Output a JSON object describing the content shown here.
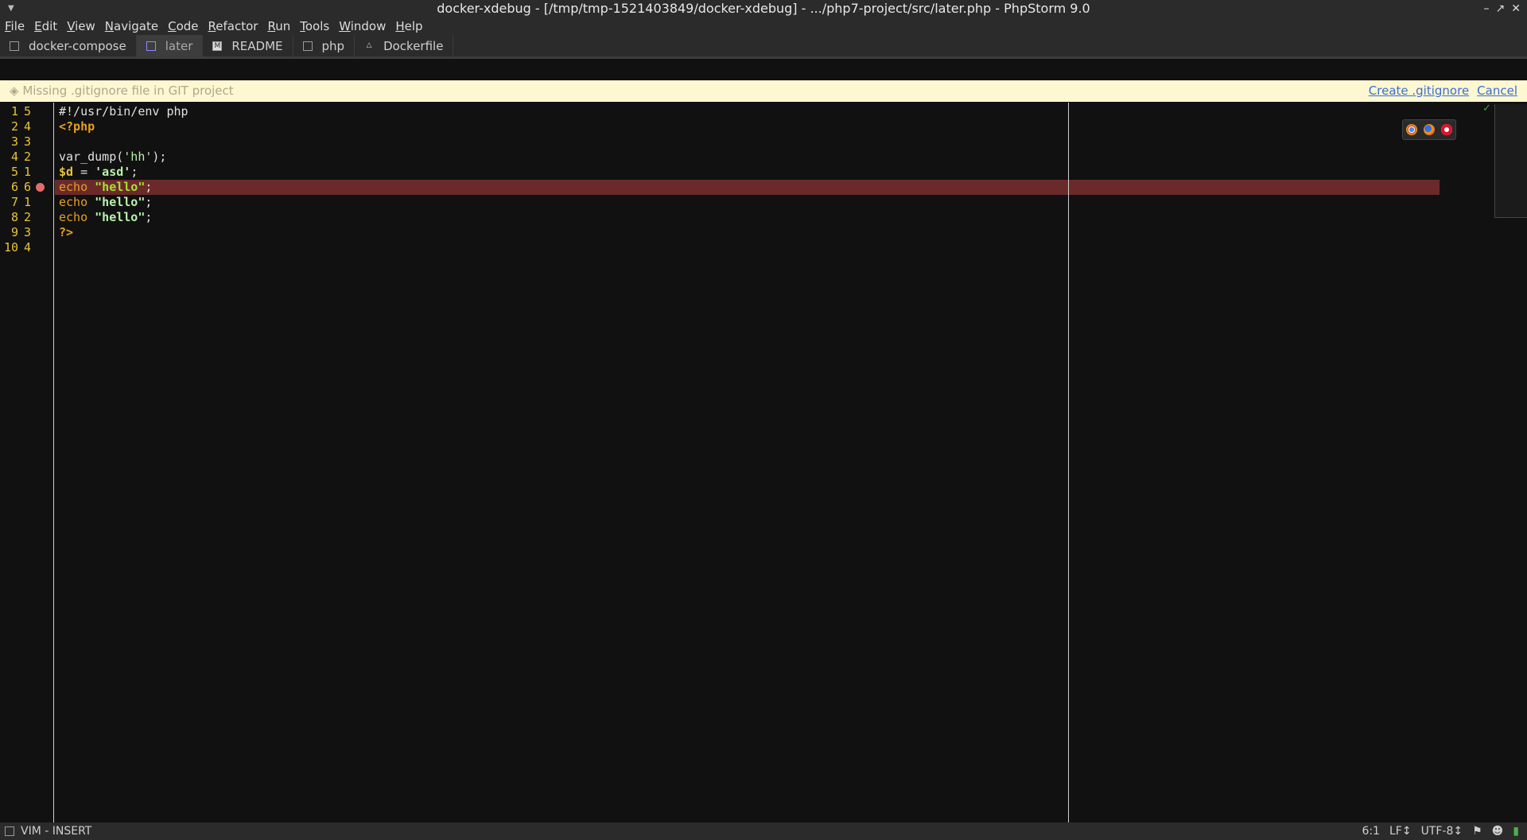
{
  "window": {
    "title": "docker-xdebug - [/tmp/tmp-1521403849/docker-xdebug] - .../php7-project/src/later.php - PhpStorm 9.0",
    "controls": [
      "minimize-icon",
      "maximize-icon",
      "close-icon"
    ]
  },
  "menu": [
    {
      "u": "F",
      "rest": "ile"
    },
    {
      "u": "E",
      "rest": "dit"
    },
    {
      "u": "V",
      "rest": "iew"
    },
    {
      "u": "N",
      "rest": "avigate"
    },
    {
      "u": "C",
      "rest": "ode"
    },
    {
      "u": "R",
      "rest": "efactor"
    },
    {
      "u": "R",
      "rest": "un"
    },
    {
      "u": "T",
      "rest": "ools"
    },
    {
      "u": "W",
      "rest": "indow"
    },
    {
      "u": "H",
      "rest": "elp"
    }
  ],
  "tabs": [
    {
      "label": "docker-compose",
      "icon": "yaml-file-icon",
      "active": false
    },
    {
      "label": "later",
      "icon": "php-file-icon",
      "active": true
    },
    {
      "label": "README",
      "icon": "markdown-file-icon",
      "active": false
    },
    {
      "label": "php",
      "icon": "text-file-icon",
      "active": false
    },
    {
      "label": "Dockerfile",
      "icon": "docker-icon",
      "active": false
    }
  ],
  "notice": {
    "message": "Missing .gitignore file in GIT project",
    "create_label": "Create .gitignore",
    "cancel_label": "Cancel"
  },
  "gutter": [
    {
      "a": "1",
      "b": "5"
    },
    {
      "a": "2",
      "b": "4"
    },
    {
      "a": "3",
      "b": "3"
    },
    {
      "a": "4",
      "b": "2"
    },
    {
      "a": "5",
      "b": "1"
    },
    {
      "a": "6",
      "b": "6",
      "breakpoint": true
    },
    {
      "a": "7",
      "b": "1"
    },
    {
      "a": "8",
      "b": "2"
    },
    {
      "a": "9",
      "b": "3"
    },
    {
      "a": "10",
      "b": "4"
    }
  ],
  "code": {
    "l1": "#!/usr/bin/env php",
    "l2": "<?php",
    "l4_fn": "var_dump(",
    "l4_str": "'hh'",
    "l4_end": ");",
    "l5_var": "$d",
    "l5_eq": " = ",
    "l5_str": "'asd'",
    "l5_end": ";",
    "echo": "echo",
    "hello": "\"hello\"",
    "semi": ";",
    "l9": "?>"
  },
  "highlighted_line": 6,
  "browsers": [
    "chrome-icon",
    "firefox-icon",
    "opera-icon"
  ],
  "status": {
    "mode": "VIM - INSERT",
    "position": "6:1",
    "line_sep": "LF↕",
    "encoding": "UTF-8↕"
  },
  "colors": {
    "keyword": "#e59f25",
    "string": "#a6e22e",
    "line_number": "#e8c43a",
    "breakpoint_line": "#6b2a2a",
    "breakpoint": "#e06c6c"
  }
}
